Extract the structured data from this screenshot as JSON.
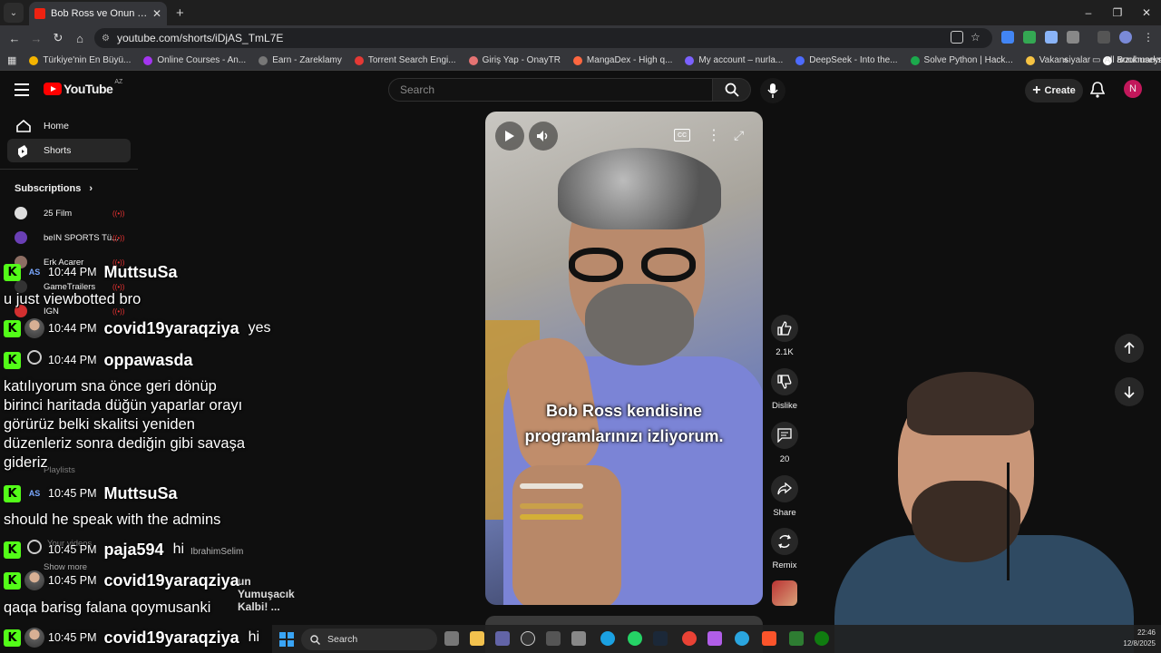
{
  "browser": {
    "tab_title": "Bob Ross ve Onun Yumuşacık Kalbi! ...",
    "url": "youtube.com/shorts/iDjAS_TmL7E",
    "window_controls": [
      "–",
      "❐",
      "✕"
    ],
    "bookmarks": [
      {
        "label": "Türkiye'nin En Büyü...",
        "color": "#f4b400"
      },
      {
        "label": "Online Courses - An...",
        "color": "#a435f0"
      },
      {
        "label": "Earn - Zareklamy",
        "color": "#777777"
      },
      {
        "label": "Torrent Search Engi...",
        "color": "#e53935"
      },
      {
        "label": "Giriş Yap - OnayTR",
        "color": "#e57373"
      },
      {
        "label": "MangaDex - High q...",
        "color": "#ff6740"
      },
      {
        "label": "My account – nurla...",
        "color": "#7b61ff"
      },
      {
        "label": "DeepSeek - Into the...",
        "color": "#4d6bfe"
      },
      {
        "label": "Solve Python | Hack...",
        "color": "#1ba94c"
      },
      {
        "label": "Vakansiyalar",
        "color": "#f6c343"
      },
      {
        "label": "arzuhuseyn (Arzu H...",
        "color": "#ffffff"
      }
    ],
    "all_bookmarks": "All Bookmarks"
  },
  "youtube": {
    "logo_text": "YouTube",
    "country_code": "AZ",
    "search_placeholder": "Search",
    "create_label": "Create",
    "avatar_letter": "N",
    "sidebar": {
      "home": "Home",
      "shorts": "Shorts",
      "subscriptions_title": "Subscriptions",
      "subscriptions": [
        {
          "name": "25 Film",
          "color": "#dddddd"
        },
        {
          "name": "beIN SPORTS Tü...",
          "color": "#6a3fb5"
        },
        {
          "name": "Erk Acarer",
          "color": "#8d6e63"
        },
        {
          "name": "GameTrailers",
          "color": "#333333"
        },
        {
          "name": "IGN",
          "color": "#d32f2f"
        }
      ],
      "ghost_labels": [
        "Playlists",
        "Your videos",
        "Show more",
        "IbrahimSelim"
      ]
    },
    "video": {
      "caption_line1": "Bob Ross kendisine",
      "caption_line2": "programlarınızı izliyorum."
    },
    "actions": {
      "likes": "2.1K",
      "dislike": "Dislike",
      "comments": "20",
      "share": "Share",
      "remix": "Remix"
    }
  },
  "chat": {
    "rows": [
      {
        "time": "10:44 PM",
        "user": "MuttsuSa",
        "avatar": "badge",
        "inline": ""
      },
      {
        "time": "10:44 PM",
        "user": "covid19yaraqziya",
        "avatar": "photo",
        "inline": "yes"
      },
      {
        "time": "10:44 PM",
        "user": "oppawasda",
        "avatar": "default",
        "inline": ""
      },
      {
        "time": "10:45 PM",
        "user": "MuttsuSa",
        "avatar": "badge",
        "inline": ""
      },
      {
        "time": "10:45 PM",
        "user": "paja594",
        "avatar": "default",
        "inline": "hi"
      },
      {
        "time": "10:45 PM",
        "user": "covid19yaraqziya",
        "avatar": "photo",
        "inline": ""
      },
      {
        "time": "10:45 PM",
        "user": "covid19yaraqziya",
        "avatar": "photo",
        "inline": "hi"
      }
    ],
    "messages": {
      "m1": "u just viewbotted bro",
      "m3_l1": "katılıyorum sna önce geri dönüp",
      "m3_l2": "birinci haritada düğün yaparlar orayı",
      "m3_l3": "görürüz belki skalitsi yeniden",
      "m3_l4": "düzenleriz sonra dediğin gibi savaşa",
      "m3_l5": "gideriz",
      "m4": "should he speak with the admins",
      "m6": "qaqa barisg falana qoymusanki"
    },
    "overlap_title": "un Yumuşacık Kalbi! ..."
  },
  "taskbar": {
    "search_label": "Search",
    "time": "22:46",
    "date": "12/8/2025"
  }
}
